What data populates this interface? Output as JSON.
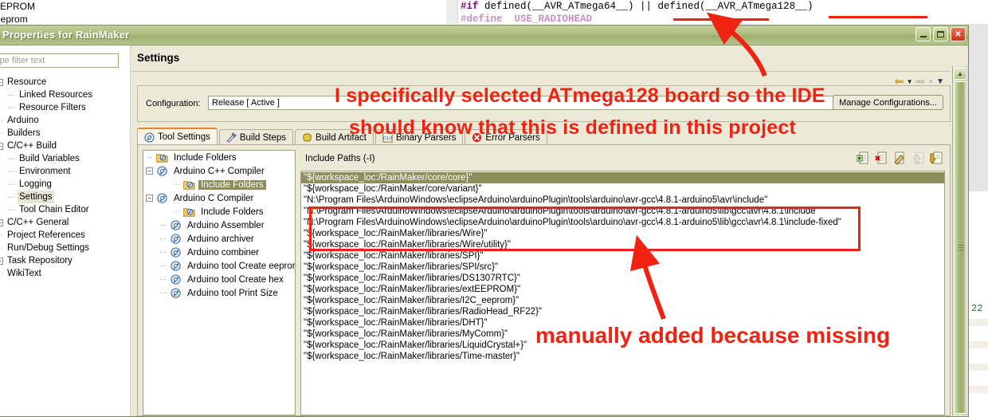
{
  "background": {
    "text_top_left_1": "EEPROM",
    "text_top_left_2": "eeprom",
    "code_line_1_directive": "#if",
    "code_line_1_rest": " defined(__AVR_ATmega64__) || defined(__AVR_ATmega128__)",
    "code_line_2": "#define  USE_RADIOHEAD",
    "right_gutter_number": "22"
  },
  "dialog": {
    "title": "Properties for RainMaker",
    "window_buttons": {
      "minimize": "_",
      "maximize": "□",
      "close": "✕"
    }
  },
  "filter": {
    "placeholder": "type filter text",
    "value": "type filter text"
  },
  "sidebar": {
    "items": [
      {
        "label": "Resource",
        "indent": 0,
        "expander": "−",
        "selected": false
      },
      {
        "label": "Linked Resources",
        "indent": 1,
        "expander": "",
        "selected": false
      },
      {
        "label": "Resource Filters",
        "indent": 1,
        "expander": "",
        "selected": false
      },
      {
        "label": "Arduino",
        "indent": 0,
        "expander": "",
        "selected": false
      },
      {
        "label": "Builders",
        "indent": 0,
        "expander": "",
        "selected": false
      },
      {
        "label": "C/C++ Build",
        "indent": 0,
        "expander": "−",
        "selected": false
      },
      {
        "label": "Build Variables",
        "indent": 1,
        "expander": "",
        "selected": false
      },
      {
        "label": "Environment",
        "indent": 1,
        "expander": "",
        "selected": false
      },
      {
        "label": "Logging",
        "indent": 1,
        "expander": "",
        "selected": false
      },
      {
        "label": "Settings",
        "indent": 1,
        "expander": "",
        "selected": true
      },
      {
        "label": "Tool Chain Editor",
        "indent": 1,
        "expander": "",
        "selected": false
      },
      {
        "label": "C/C++ General",
        "indent": 0,
        "expander": "+",
        "selected": false
      },
      {
        "label": "Project References",
        "indent": 0,
        "expander": "",
        "selected": false
      },
      {
        "label": "Run/Debug Settings",
        "indent": 0,
        "expander": "",
        "selected": false
      },
      {
        "label": "Task Repository",
        "indent": 0,
        "expander": "+",
        "selected": false
      },
      {
        "label": "WikiText",
        "indent": 0,
        "expander": "",
        "selected": false
      }
    ]
  },
  "page": {
    "title": "Settings",
    "nav": {
      "back_icon": "left-arrow-icon",
      "forward_icon": "right-arrow-icon",
      "menu_icon": "chevron-down-icon"
    }
  },
  "configuration": {
    "label": "Configuration:",
    "value": "Release [ Active ]",
    "manage_button": "Manage Configurations..."
  },
  "tabs": [
    {
      "label": "Tool Settings",
      "icon": "tool-settings-icon",
      "active": true
    },
    {
      "label": "Build Steps",
      "icon": "build-steps-icon",
      "active": false
    },
    {
      "label": "Build Artifact",
      "icon": "build-artifact-icon",
      "active": false
    },
    {
      "label": "Binary Parsers",
      "icon": "binary-parsers-icon",
      "active": false
    },
    {
      "label": "Error Parsers",
      "icon": "error-parsers-icon",
      "active": false
    }
  ],
  "tool_tree": [
    {
      "label": "Include Folders",
      "level": 1,
      "expander": "",
      "icon": "folder-icon",
      "selected": false
    },
    {
      "label": "Arduino C++ Compiler",
      "level": 1,
      "expander": "−",
      "icon": "tool-icon",
      "selected": false
    },
    {
      "label": "Include Folders",
      "level": 3,
      "expander": "",
      "icon": "folder-icon",
      "selected": true
    },
    {
      "label": "Arduino C Compiler",
      "level": 1,
      "expander": "−",
      "icon": "tool-icon",
      "selected": false
    },
    {
      "label": "Include Folders",
      "level": 3,
      "expander": "",
      "icon": "folder-icon",
      "selected": false
    },
    {
      "label": "Arduino Assembler",
      "level": 2,
      "expander": "",
      "icon": "tool-icon",
      "selected": false
    },
    {
      "label": "Arduino archiver",
      "level": 2,
      "expander": "",
      "icon": "tool-icon",
      "selected": false
    },
    {
      "label": "Arduino combiner",
      "level": 2,
      "expander": "",
      "icon": "tool-icon",
      "selected": false
    },
    {
      "label": "Arduino tool Create eeprom",
      "level": 2,
      "expander": "",
      "icon": "tool-icon",
      "selected": false
    },
    {
      "label": "Arduino tool Create hex",
      "level": 2,
      "expander": "",
      "icon": "tool-icon",
      "selected": false
    },
    {
      "label": "Arduino tool Print Size",
      "level": 2,
      "expander": "",
      "icon": "tool-icon",
      "selected": false
    }
  ],
  "include_paths": {
    "title": "Include Paths (-I)",
    "toolbar": [
      {
        "name": "add-path-button",
        "enabled": true
      },
      {
        "name": "delete-path-button",
        "enabled": true
      },
      {
        "name": "edit-path-button",
        "enabled": true
      },
      {
        "name": "move-up-button",
        "enabled": false
      },
      {
        "name": "move-down-button",
        "enabled": true
      }
    ],
    "rows": [
      {
        "text": "\"${workspace_loc:/RainMaker/core/core}\"",
        "selected": true
      },
      {
        "text": "\"${workspace_loc:/RainMaker/core/variant}\"",
        "selected": false
      },
      {
        "text": "\"N:\\Program Files\\ArduinoWindows\\eclipseArduino\\arduinoPlugin\\tools\\arduino\\avr-gcc\\4.8.1-arduino5\\avr\\include\"",
        "selected": false
      },
      {
        "text": "\"N:\\Program Files\\ArduinoWindows\\eclipseArduino\\arduinoPlugin\\tools\\arduino\\avr-gcc\\4.8.1-arduino5\\lib\\gcc\\avr\\4.8.1\\include\"",
        "selected": false
      },
      {
        "text": "\"N:\\Program Files\\ArduinoWindows\\eclipseArduino\\arduinoPlugin\\tools\\arduino\\avr-gcc\\4.8.1-arduino5\\lib\\gcc\\avr\\4.8.1\\include-fixed\"",
        "selected": false
      },
      {
        "text": "\"${workspace_loc:/RainMaker/libraries/Wire}\"",
        "selected": false
      },
      {
        "text": "\"${workspace_loc:/RainMaker/libraries/Wire/utility}\"",
        "selected": false
      },
      {
        "text": "\"${workspace_loc:/RainMaker/libraries/SPI}\"",
        "selected": false
      },
      {
        "text": "\"${workspace_loc:/RainMaker/libraries/SPI/src}\"",
        "selected": false
      },
      {
        "text": "\"${workspace_loc:/RainMaker/libraries/DS1307RTC}\"",
        "selected": false
      },
      {
        "text": "\"${workspace_loc:/RainMaker/libraries/extEEPROM}\"",
        "selected": false
      },
      {
        "text": "\"${workspace_loc:/RainMaker/libraries/I2C_eeprom}\"",
        "selected": false
      },
      {
        "text": "\"${workspace_loc:/RainMaker/libraries/RadioHead_RF22}\"",
        "selected": false
      },
      {
        "text": "\"${workspace_loc:/RainMaker/libraries/DHT}\"",
        "selected": false
      },
      {
        "text": "\"${workspace_loc:/RainMaker/libraries/MyComm}\"",
        "selected": false
      },
      {
        "text": "\"${workspace_loc:/RainMaker/libraries/LiquidCrystal+}\"",
        "selected": false
      },
      {
        "text": "\"${workspace_loc:/RainMaker/libraries/Time-master}\"",
        "selected": false
      }
    ]
  },
  "annotations": {
    "color": "#f02211",
    "note_top_line1": "I specifically selected ATmega128 board so the IDE",
    "note_top_line2": "should know that this is defined in this project",
    "note_bottom": "manually added because missing"
  }
}
